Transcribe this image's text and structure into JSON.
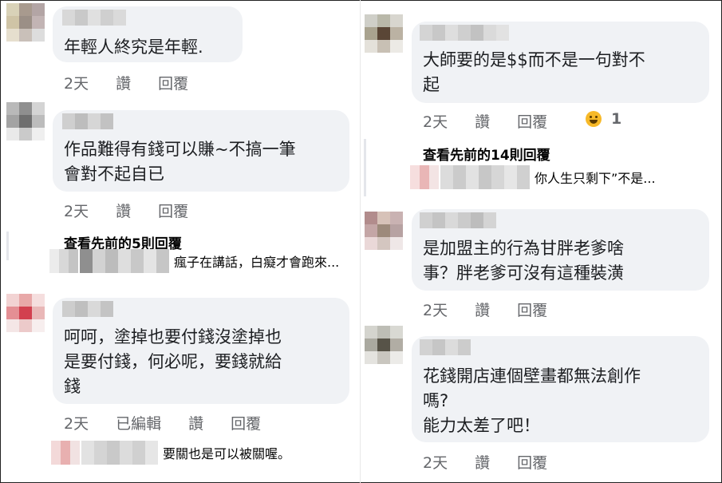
{
  "left": [
    {
      "text": "年輕人終究是年輕.",
      "actions": [
        "2天",
        "讚",
        "回覆"
      ]
    },
    {
      "text": "作品難得有錢可以賺~不搞一筆\n會對不起自已",
      "actions": [
        "2天",
        "讚",
        "回覆"
      ],
      "view_previous": "查看先前的5則回覆",
      "reply": "瘋子在講話，白癡才會跑來..."
    },
    {
      "text": "呵呵，塗掉也要付錢沒塗掉也\n是要付錢，何必呢，要錢就給\n錢",
      "actions": [
        "2天",
        "已編輯",
        "讚",
        "回覆"
      ],
      "reply": "要關也是可以被關喔。"
    }
  ],
  "right": [
    {
      "text": "大師要的是$$而不是一句對不\n起",
      "actions": [
        "2天",
        "讚",
        "回覆"
      ],
      "reaction_count": "1",
      "view_previous": "查看先前的14則回覆",
      "reply": "你人生只剩下”不是..."
    },
    {
      "text": "是加盟主的行為甘胖老爹啥\n事？胖老爹可沒有這種裝潢",
      "actions": [
        "2天",
        "讚",
        "回覆"
      ]
    },
    {
      "text": "花錢開店連個壁畫都無法創作\n嗎?\n能力太差了吧！",
      "actions": [
        "2天",
        "讚",
        "回覆"
      ]
    }
  ],
  "icons": {
    "reaction": "haha-emoji-icon"
  },
  "colors": {
    "bubble": "#f0f2f5",
    "meta": "#65676b",
    "text": "#1c1e21"
  }
}
